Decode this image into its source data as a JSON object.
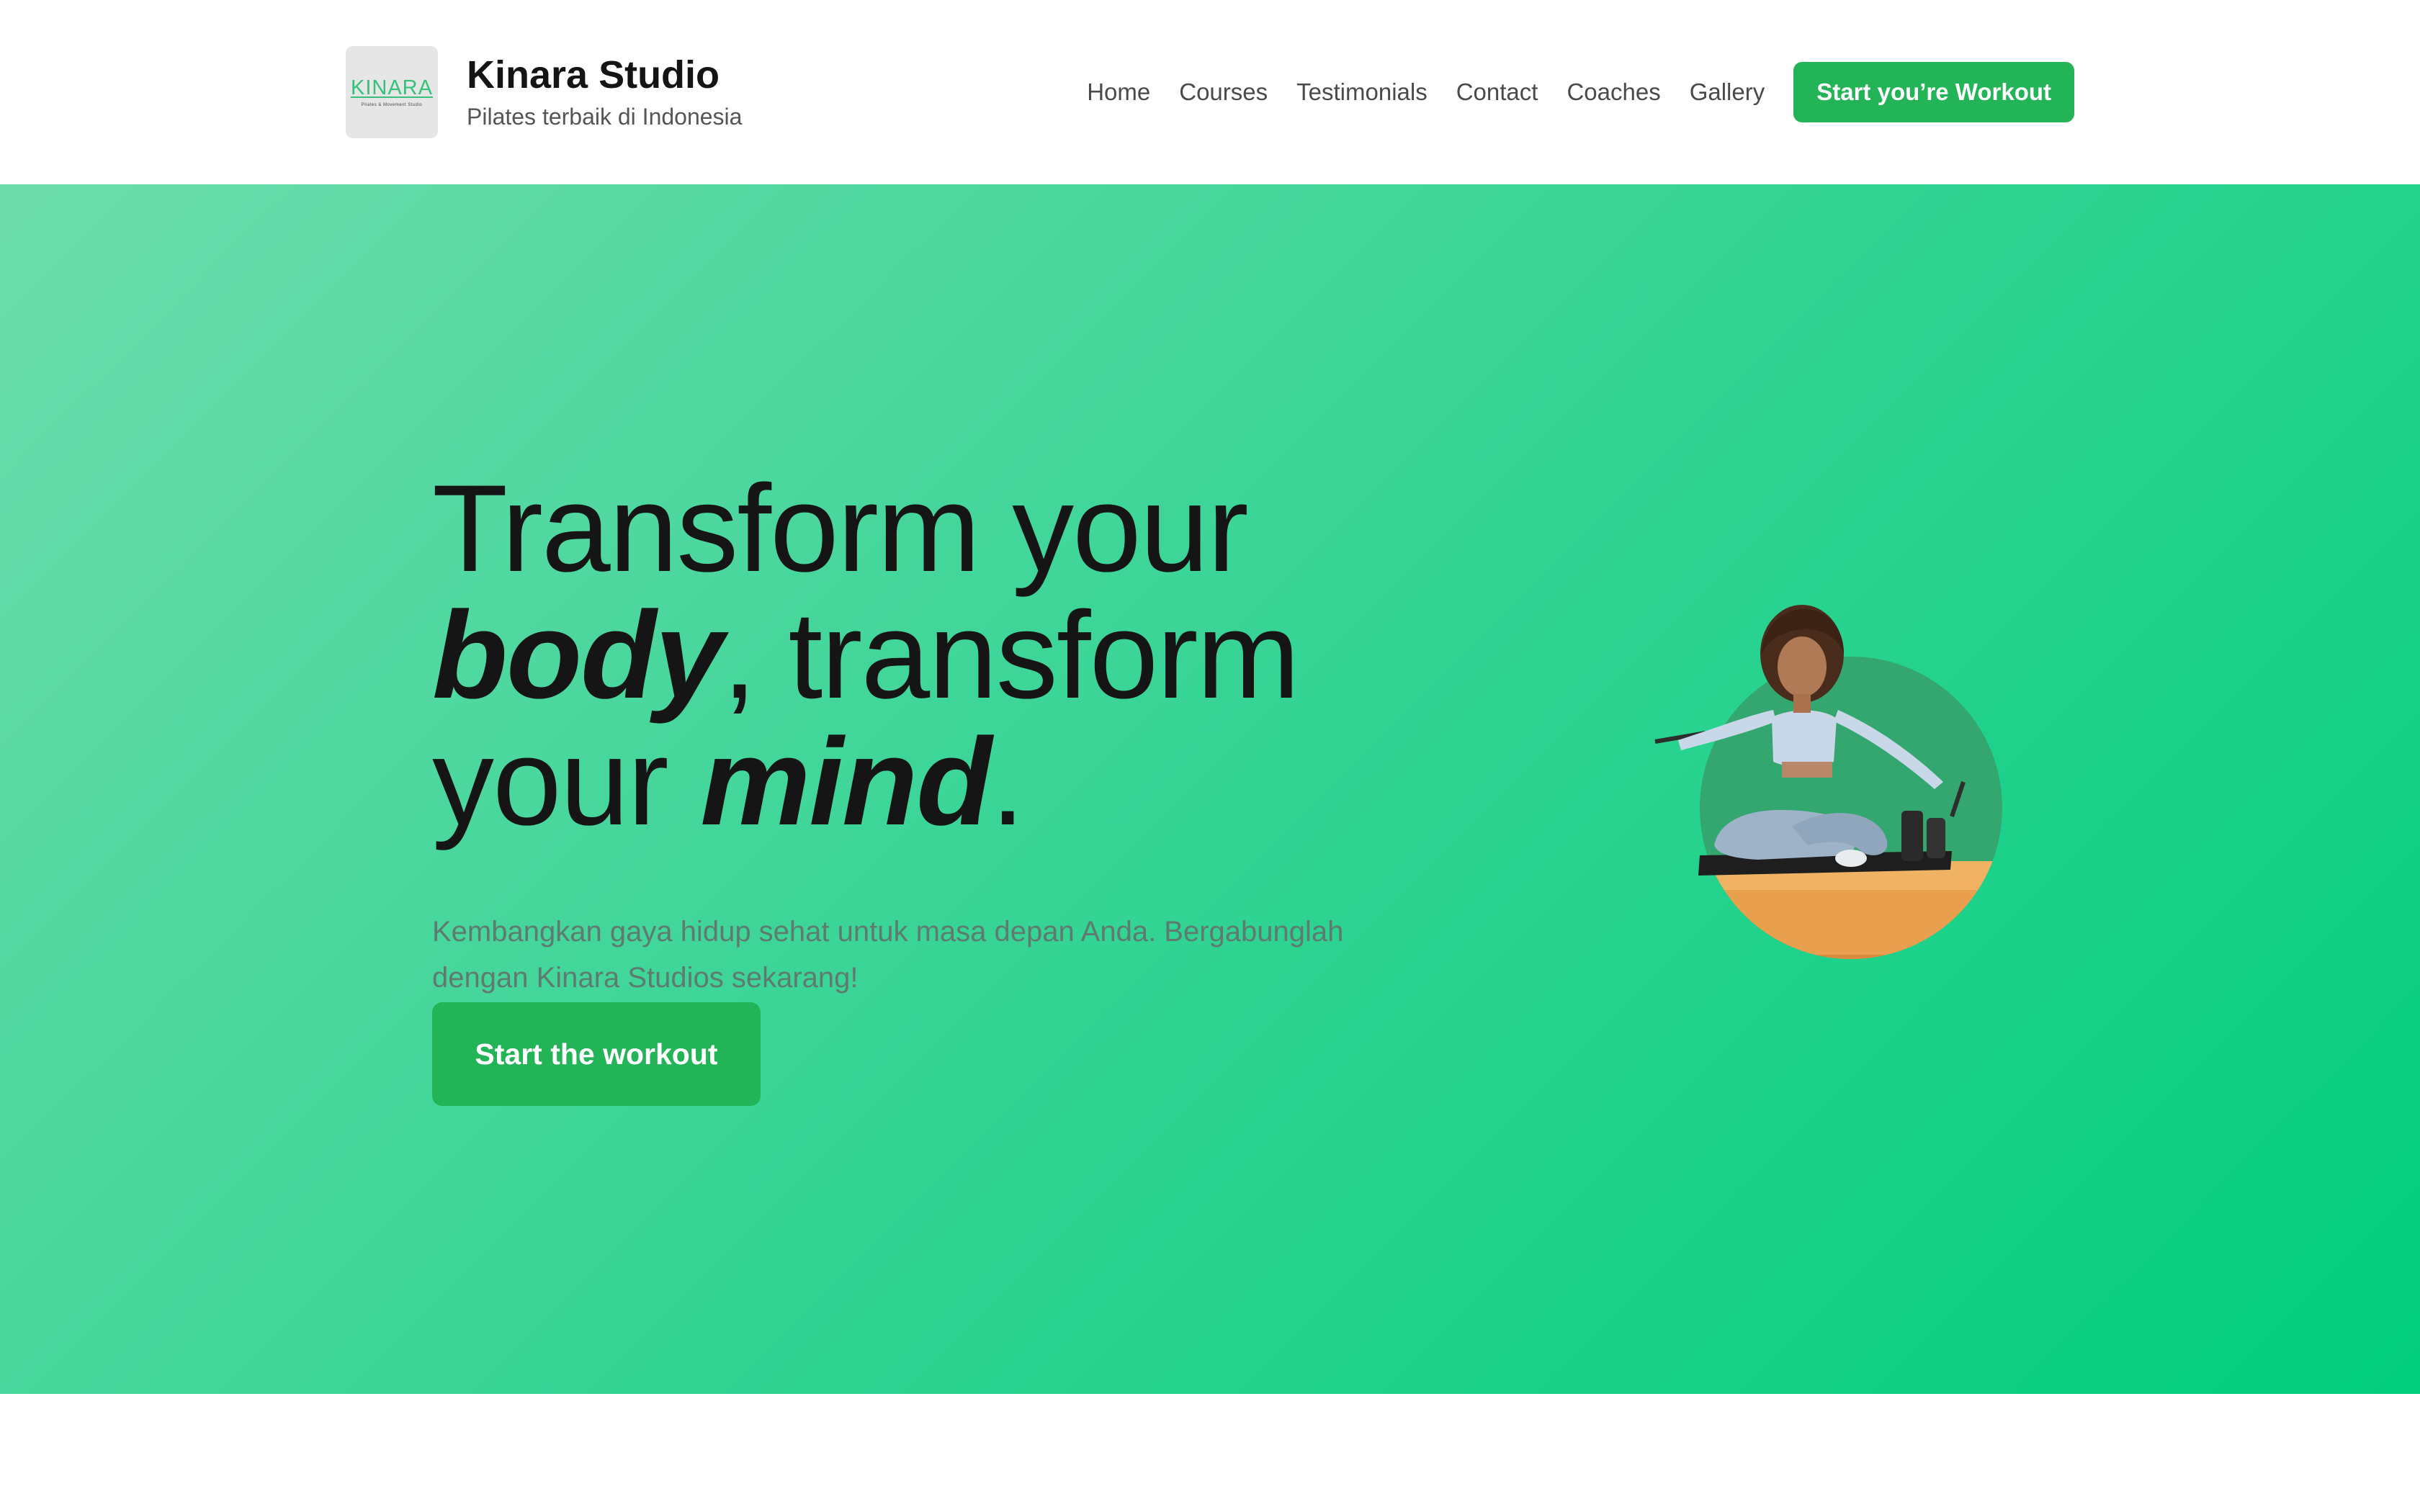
{
  "brand": {
    "logo_text": "KINARA",
    "logo_subtext": "Pilates & Movement Studio",
    "title": "Kinara Studio",
    "tagline": "Pilates terbaik di Indonesia"
  },
  "nav": {
    "items": [
      "Home",
      "Courses",
      "Testimonials",
      "Contact",
      "Coaches",
      "Gallery"
    ],
    "cta_label": "Start you’re Workout"
  },
  "hero": {
    "headline": {
      "line1": "Transform your",
      "line2_bold": "body",
      "line2_rest": ", transform",
      "line3_start": "your ",
      "line3_bold": "mind",
      "line3_end": "."
    },
    "subtitle": "Kembangkan gaya hidup sehat untuk masa depan Anda. Bergabunglah dengan Kinara Studios sekarang!",
    "cta_label": "Start the workout",
    "image": "woman-pilates-reformer-photo"
  },
  "colors": {
    "accent": "#22b456",
    "hero_gradient_start": "#6ddcad",
    "hero_gradient_end": "#02ce7e",
    "headline": "#151515",
    "subtitle": "#5f7a70"
  }
}
